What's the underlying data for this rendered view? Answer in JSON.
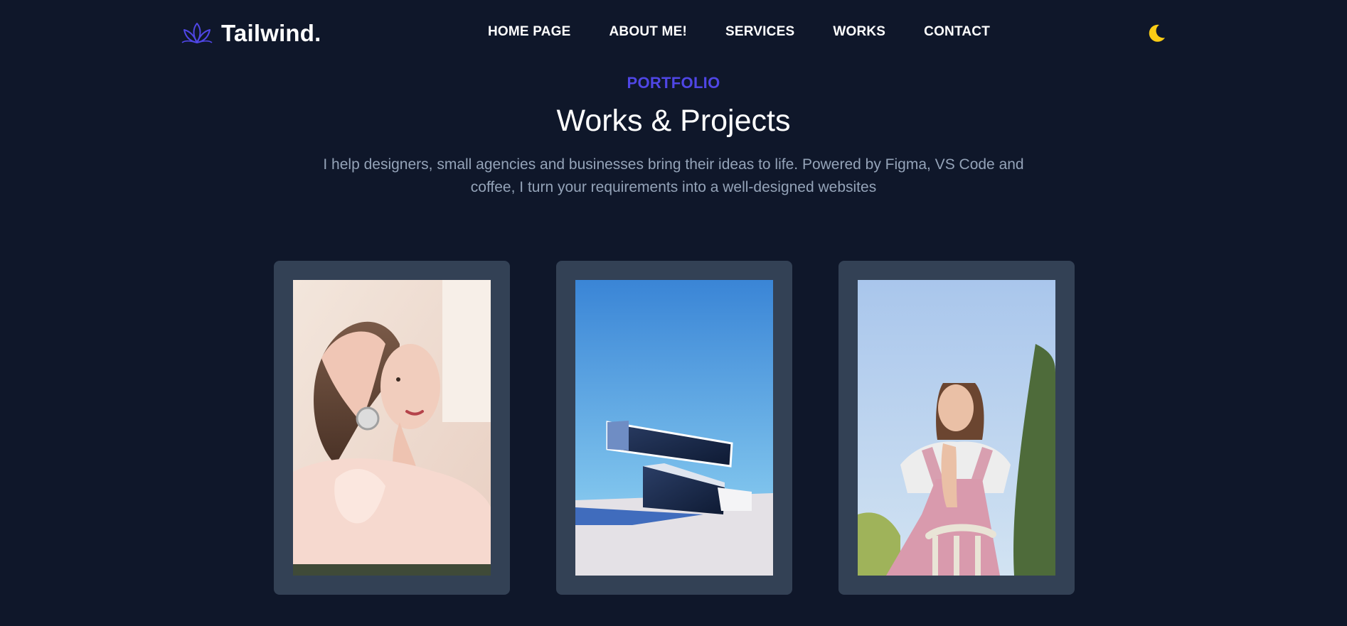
{
  "brand": {
    "name": "Tailwind.",
    "logo_icon": "lotus-icon"
  },
  "nav": {
    "items": [
      {
        "label": "HOME PAGE"
      },
      {
        "label": "ABOUT ME!"
      },
      {
        "label": "SERVICES"
      },
      {
        "label": "WORKS"
      },
      {
        "label": "CONTACT"
      }
    ]
  },
  "theme_toggle": {
    "icon": "moon-icon",
    "color": "#facc15"
  },
  "section": {
    "eyebrow": "PORTFOLIO",
    "title": "Works & Projects",
    "description": "I help designers, small agencies and businesses bring their ideas to life. Powered by Figma, VS Code and coffee, I turn your requirements into a well-designed websites"
  },
  "projects": [
    {
      "image": "woman-with-wristwatch-photo"
    },
    {
      "image": "abstract-architecture-photo"
    },
    {
      "image": "woman-on-chair-photo"
    }
  ],
  "colors": {
    "background": "#0f172a",
    "accent": "#4f46e5",
    "card": "#334155",
    "muted_text": "#94a3b8"
  }
}
